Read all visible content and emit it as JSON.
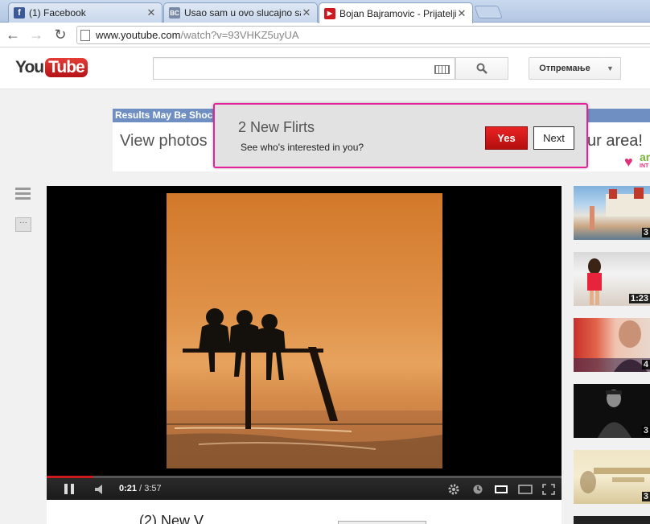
{
  "browser": {
    "tabs": [
      {
        "title": "(1) Facebook",
        "icon": "facebook-icon"
      },
      {
        "title": "Usao sam u ovo slucajno sad",
        "icon": "page-icon"
      },
      {
        "title": "Bojan Bajramovic - Prijatelji (M",
        "icon": "youtube-icon"
      }
    ],
    "url_domain": "www.youtube.com",
    "url_path": "/watch?v=93VHKZ5uyUA"
  },
  "header": {
    "logo_you": "You",
    "logo_tube": "Tube",
    "search_value": "",
    "upload_label": "Отпремање"
  },
  "ad": {
    "bar_text": "Results May Be Shock",
    "left_text": "View photos",
    "right_text": "ur area!",
    "brand": "ar",
    "brand_sub": "INT"
  },
  "popup": {
    "title": "2 New Flirts",
    "text": "See who's interested in you?",
    "yes_label": "Yes",
    "next_label": "Next"
  },
  "player": {
    "current_time": "0:21",
    "total_time": "/ 3:57",
    "progress": 0.09
  },
  "below": {
    "text": "(2) New V"
  },
  "related": [
    {
      "duration": "3"
    },
    {
      "duration": "1:23"
    },
    {
      "duration": "4"
    },
    {
      "duration": "3"
    },
    {
      "duration": "3"
    }
  ],
  "colors": {
    "youtube_red": "#cc181e",
    "popup_border": "#e3229c",
    "ad_bar": "#6f8fc2"
  }
}
